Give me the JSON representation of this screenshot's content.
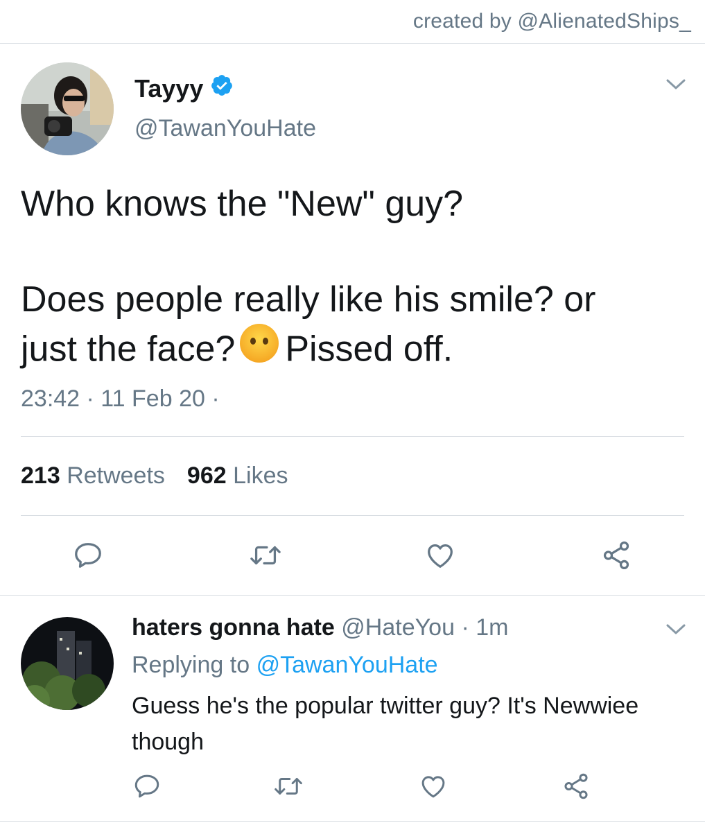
{
  "credit": "created by @AlienatedShips_",
  "tweet": {
    "author_name": "Tayyy",
    "author_handle": "@TawanYouHate",
    "verified": true,
    "text_line1": "Who knows the \"New\" guy?",
    "text_line2": "Does people really like his smile? or",
    "text_line3_before": "just the face?",
    "text_line3_after": "Pissed off.",
    "emoji": "face-without-mouth",
    "timestamp": "23:42 · 11 Feb 20 ·",
    "retweets_count": "213",
    "retweets_label": "Retweets",
    "likes_count": "962",
    "likes_label": "Likes",
    "actions": [
      "reply-icon",
      "retweet-icon",
      "like-icon",
      "share-icon"
    ]
  },
  "reply": {
    "author_name": "haters gonna hate",
    "author_handle": "@HateYou",
    "time": "· 1m",
    "replying_prefix": "Replying to",
    "replying_mention": "@TawanYouHate",
    "text": "Guess he's the popular twitter guy? It's Newwiee though",
    "actions": [
      "reply-icon",
      "retweet-icon",
      "like-icon",
      "share-icon"
    ]
  },
  "colors": {
    "accent": "#1da1f2",
    "text": "#14171a",
    "secondary": "#657786",
    "divider": "#d9dee3"
  }
}
